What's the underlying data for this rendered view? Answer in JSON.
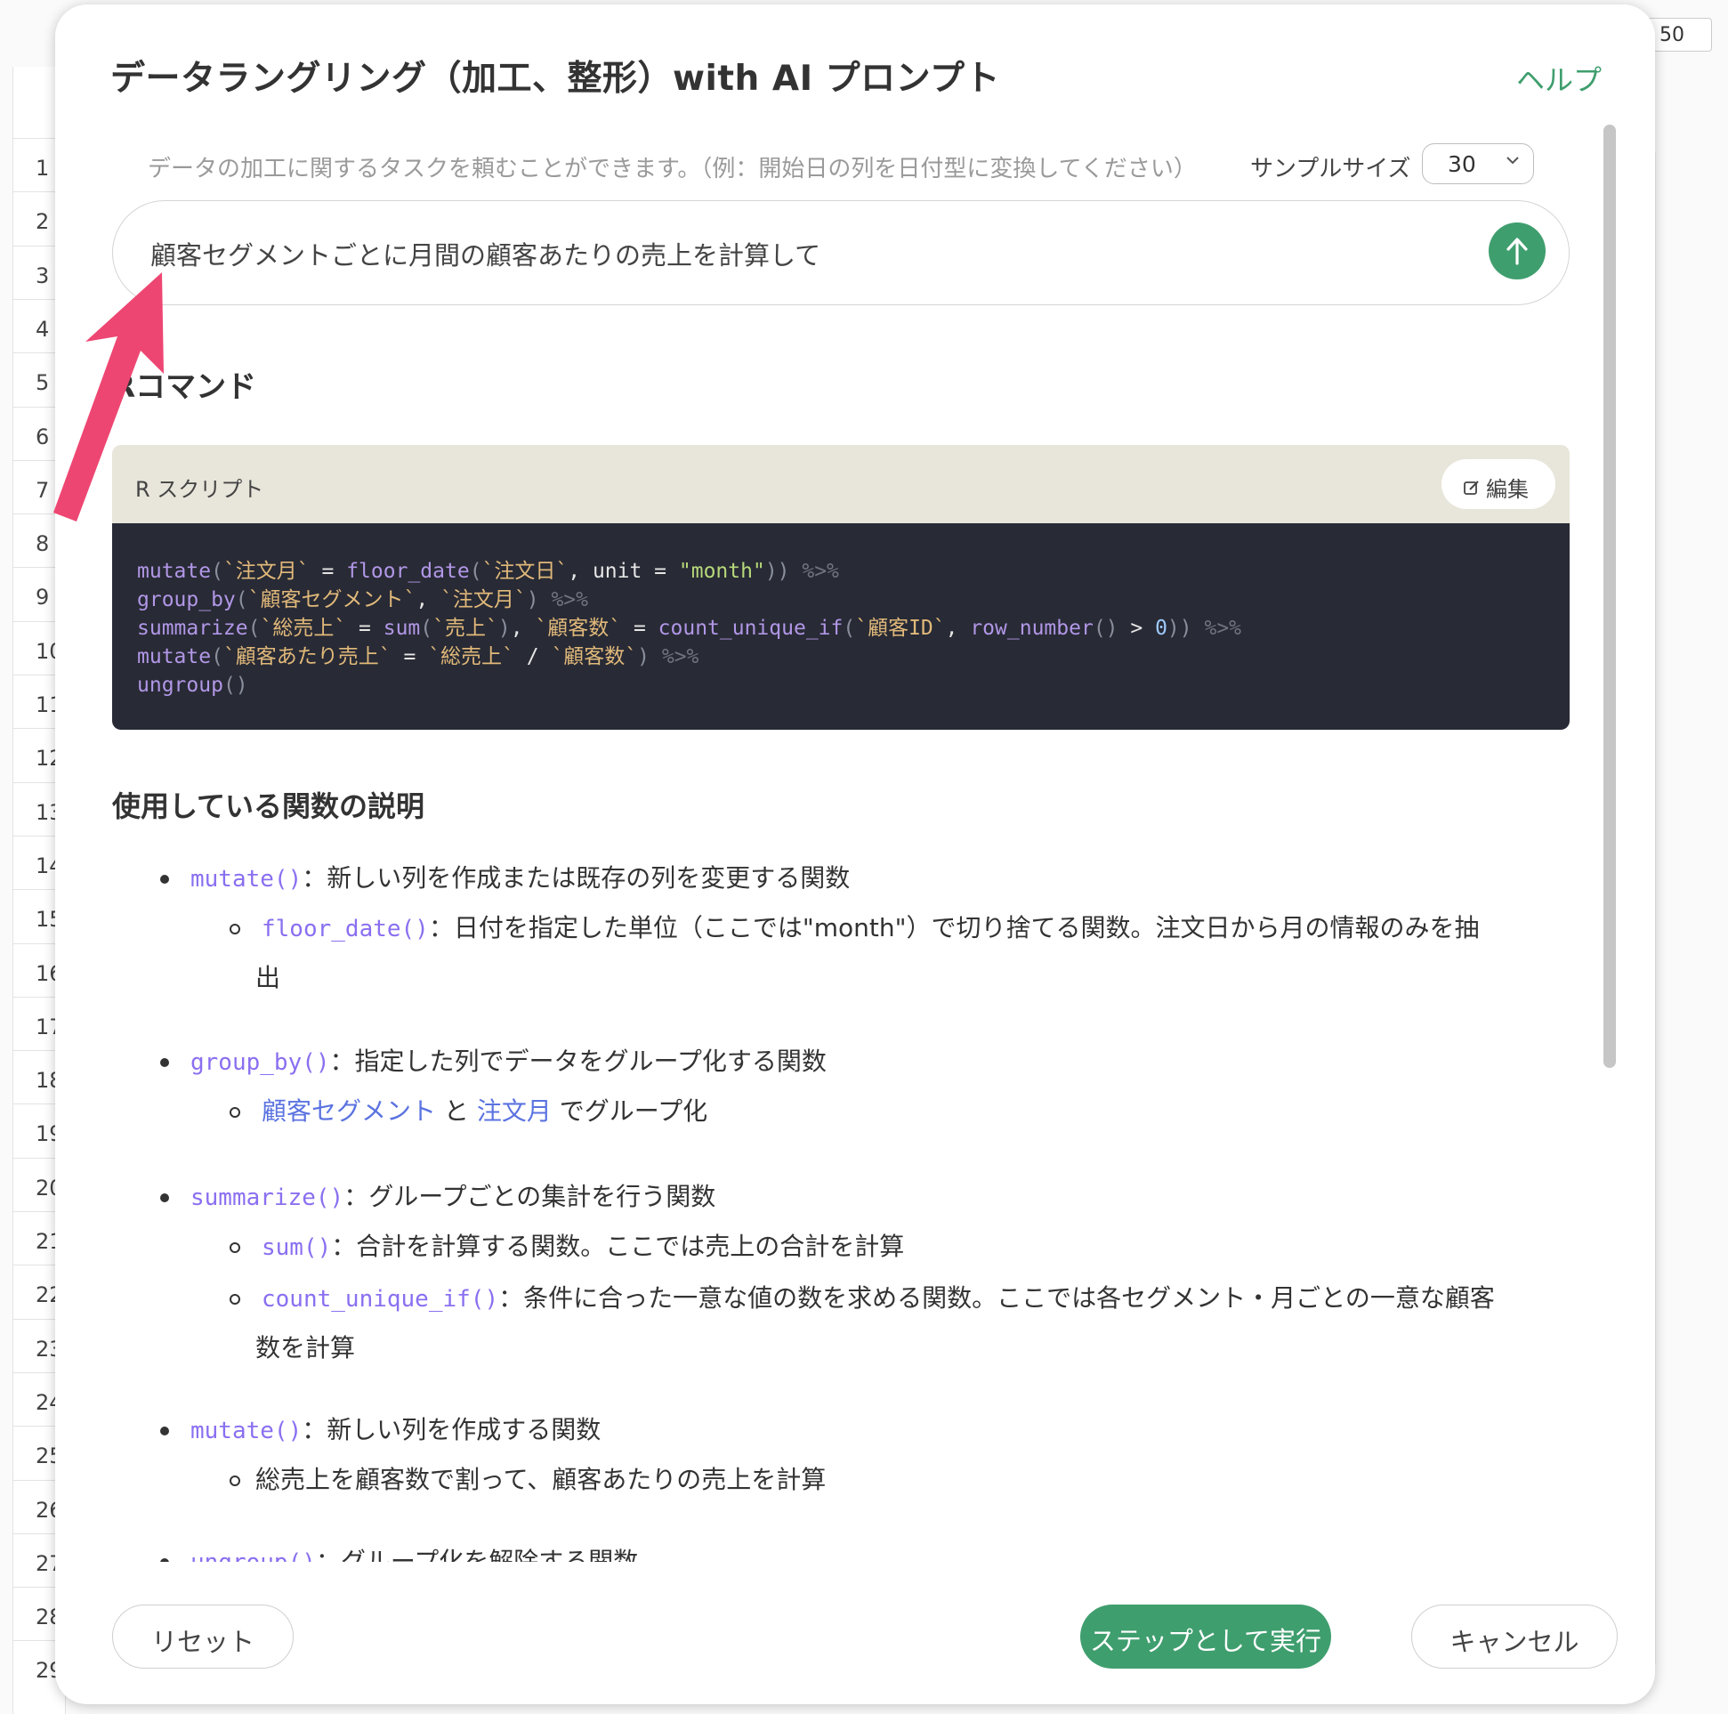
{
  "background": {
    "row_numbers": [
      "1",
      "2",
      "3",
      "4",
      "5",
      "6",
      "7",
      "8",
      "9",
      "10",
      "11",
      "12",
      "13",
      "14",
      "15",
      "16",
      "17",
      "18",
      "19",
      "20",
      "21",
      "22",
      "23",
      "24",
      "25",
      "26",
      "27",
      "28",
      "29"
    ],
    "page_size_value": "50"
  },
  "modal": {
    "title": "データラングリング（加工、整形）with AI プロンプト",
    "help_label": "ヘルプ",
    "hint": "データの加工に関するタスクを頼むことができます。（例：開始日の列を日付型に変換してください）",
    "sample_size_label": "サンプルサイズ",
    "sample_size_value": "30",
    "prompt_value": "顧客セグメントごとに月間の顧客あたりの売上を計算して",
    "section_title": "Rコマンド",
    "rscript_label": "R スクリプト",
    "edit_label": "編集",
    "desc_title": "使用している関数の説明",
    "descriptions": [
      {
        "code": "mutate()",
        "text": "：新しい列を作成または既存の列を変更する関数"
      },
      {
        "code": "floor_date()",
        "text": "：日付を指定した単位（ここでは\"month\"）で切り捨てる関数。注文日から月の情報のみを抽",
        "text2": "出"
      },
      {
        "code": "group_by()",
        "text": "：指定した列でデータをグループ化する関数"
      },
      {
        "link1": "顧客セグメント",
        "and": " と ",
        "link2": "注文月",
        "text": " でグループ化"
      },
      {
        "code": "summarize()",
        "text": "：グループごとの集計を行う関数"
      },
      {
        "code": "sum()",
        "text": "：合計を計算する関数。ここでは売上の合計を計算"
      },
      {
        "code": "count_unique_if()",
        "text": "：条件に合った一意な値の数を求める関数。ここでは各セグメント・月ごとの一意な顧客",
        "text2": "数を計算"
      },
      {
        "code": "mutate()",
        "text": "：新しい列を作成する関数"
      },
      {
        "text": "総売上を顧客数で割って、顧客あたりの売上を計算"
      },
      {
        "code": "ungroup()",
        "text": "：グループ化を解除する関数"
      }
    ],
    "reset_label": "リセット",
    "run_label": "ステップとして実行",
    "cancel_label": "キャンセル"
  },
  "code_lines": [
    "mutate(`注文月` = floor_date(`注文日`, unit = \"month\")) %>%",
    "group_by(`顧客セグメント`, `注文月`) %>%",
    "summarize(`総売上` = sum(`売上`), `顧客数` = count_unique_if(`顧客ID`, row_number() > 0)) %>%",
    "mutate(`顧客あたり売上` = `総売上` / `顧客数`) %>%",
    "ungroup()"
  ],
  "colors": {
    "accent_green": "#3f9e6e",
    "code_bg": "#282a35",
    "annotation_arrow": "#ee4672"
  },
  "icons": {
    "send": "arrow-up-icon",
    "edit": "pencil-square-icon",
    "select": "chevron-down-icon"
  }
}
